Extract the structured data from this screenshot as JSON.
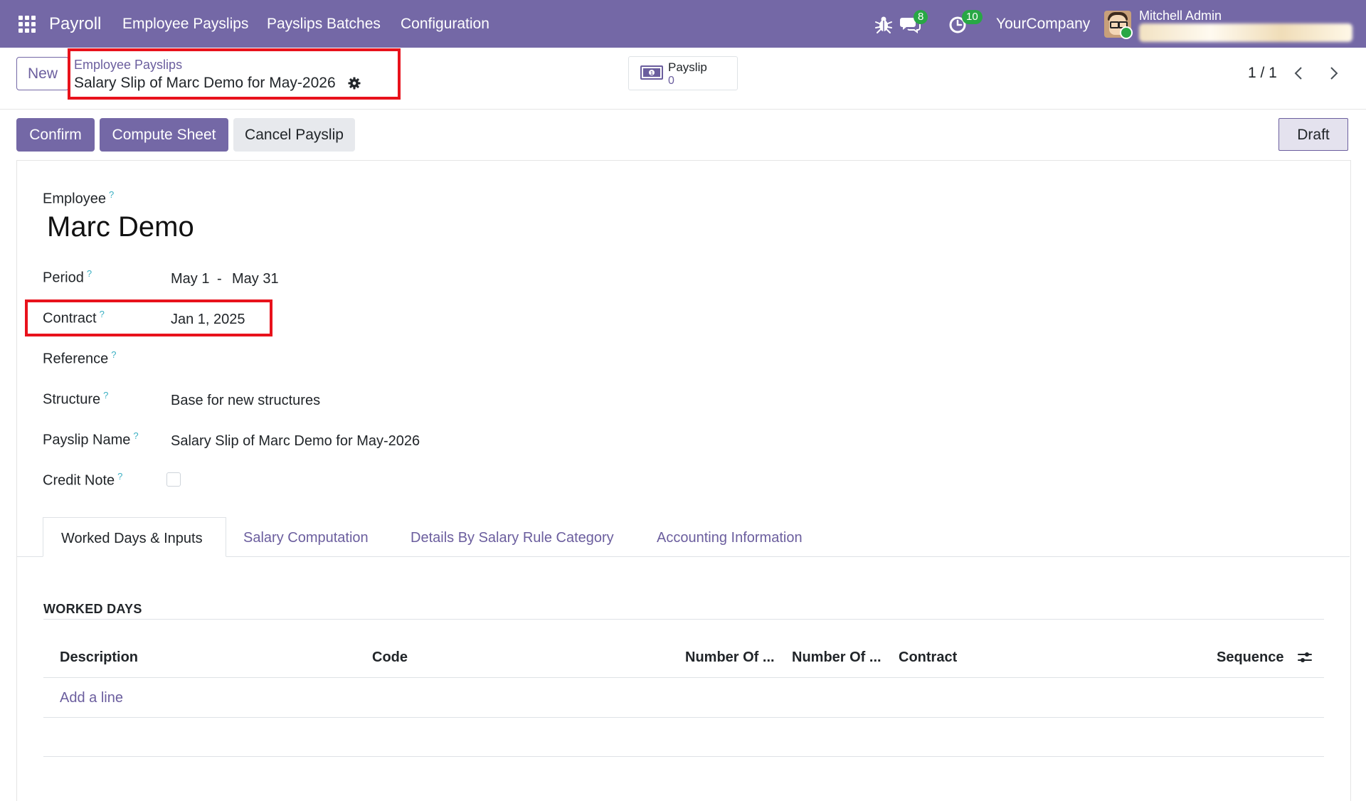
{
  "navbar": {
    "brand": "Payroll",
    "menu": [
      "Employee Payslips",
      "Payslips Batches",
      "Configuration"
    ],
    "messages_count": "8",
    "activities_count": "10",
    "company": "YourCompany",
    "user": "Mitchell Admin"
  },
  "control_panel": {
    "new_label": "New",
    "breadcrumb_parent": "Employee Payslips",
    "breadcrumb_current": "Salary Slip of Marc Demo for May-2026",
    "smart_button": {
      "label": "Payslip",
      "count": "0"
    },
    "pager": "1 / 1"
  },
  "actions": {
    "confirm": "Confirm",
    "compute_sheet": "Compute Sheet",
    "cancel_payslip": "Cancel Payslip",
    "status": "Draft"
  },
  "form": {
    "employee_label": "Employee",
    "employee_name": "Marc Demo",
    "period_label": "Period",
    "period_start": "May 1",
    "period_sep": "-",
    "period_end": "May 31",
    "contract_label": "Contract",
    "contract_value": "Jan 1, 2025",
    "reference_label": "Reference",
    "structure_label": "Structure",
    "structure_value": "Base for new structures",
    "payslip_name_label": "Payslip Name",
    "payslip_name_value": "Salary Slip of Marc Demo for May-2026",
    "credit_note_label": "Credit Note",
    "help_mark": "?"
  },
  "tabs": [
    {
      "label": "Worked Days & Inputs",
      "active": true
    },
    {
      "label": "Salary Computation"
    },
    {
      "label": "Details By Salary Rule Category"
    },
    {
      "label": "Accounting Information"
    }
  ],
  "worked_days": {
    "title": "WORKED DAYS",
    "columns": [
      "Description",
      "Code",
      "Number Of ...",
      "Number Of ...",
      "Contract",
      "Sequence"
    ],
    "add_line": "Add a line"
  },
  "colors": {
    "brand": "#7468a6",
    "link": "#6b5e9e",
    "highlight": "#e8121c",
    "badge": "#28a745"
  }
}
